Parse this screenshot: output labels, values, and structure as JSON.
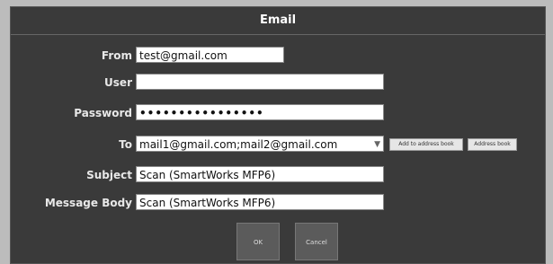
{
  "dialog": {
    "title": "Email"
  },
  "form": {
    "from": {
      "label": "From",
      "value": "test@gmail.com"
    },
    "user": {
      "label": "User",
      "value": ""
    },
    "password": {
      "label": "Password",
      "value": "••••••••••••••••"
    },
    "to": {
      "label": "To",
      "value": "mail1@gmail.com;mail2@gmail.com"
    },
    "subject": {
      "label": "Subject",
      "value": "Scan (SmartWorks MFP6)"
    },
    "message_body": {
      "label": "Message Body",
      "value": "Scan (SmartWorks MFP6)"
    }
  },
  "buttons": {
    "add_to_address_book": "Add to address book",
    "address_book": "Address book",
    "ok": "OK",
    "cancel": "Cancel"
  }
}
